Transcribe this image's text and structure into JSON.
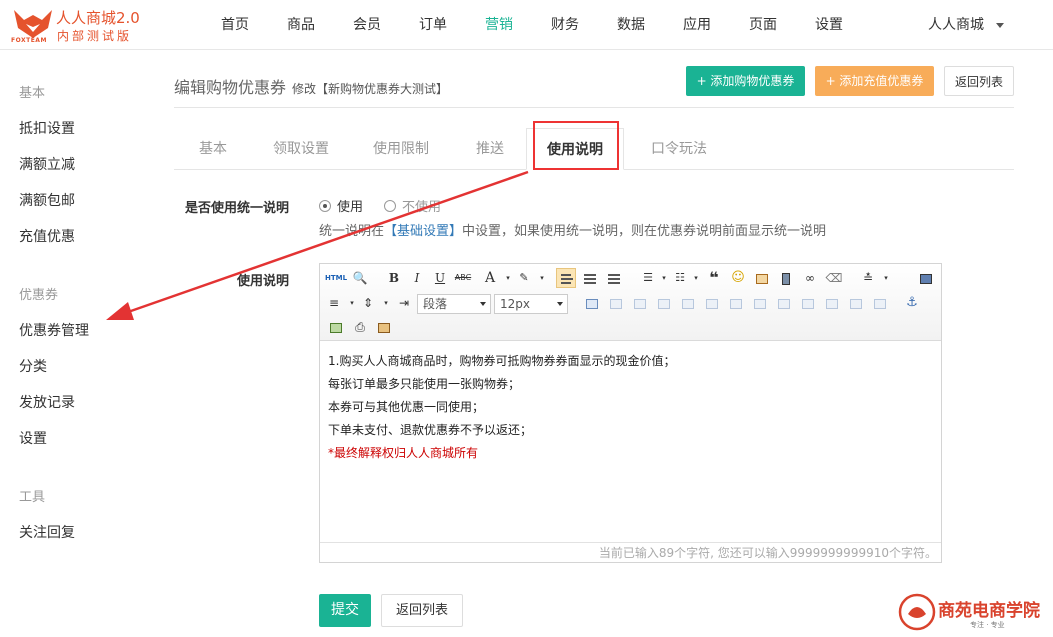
{
  "brand": {
    "name": "人人商城2.0",
    "tagline": "内部测试版",
    "logo_text": "FOXTEAM"
  },
  "nav": {
    "items": [
      {
        "label": "首页"
      },
      {
        "label": "商品"
      },
      {
        "label": "会员"
      },
      {
        "label": "订单"
      },
      {
        "label": "营销",
        "active": true
      },
      {
        "label": "财务"
      },
      {
        "label": "数据"
      },
      {
        "label": "应用"
      },
      {
        "label": "页面"
      },
      {
        "label": "设置"
      }
    ],
    "user": "人人商城"
  },
  "sidebar": {
    "groups": [
      {
        "title": "基本",
        "items": [
          "抵扣设置",
          "满额立减",
          "满额包邮",
          "充值优惠"
        ]
      },
      {
        "title": "优惠券",
        "items": [
          "优惠券管理",
          "分类",
          "发放记录",
          "设置"
        ]
      },
      {
        "title": "工具",
        "items": [
          "关注回复"
        ]
      }
    ]
  },
  "page": {
    "title": "编辑购物优惠券",
    "subtitle": "修改【新购物优惠券大测试】",
    "actions": {
      "add_shop_coupon": "+ 添加购物优惠券",
      "add_recharge_coupon": "+ 添加充值优惠券",
      "back_list": "返回列表"
    }
  },
  "tabs": [
    {
      "label": "基本"
    },
    {
      "label": "领取设置"
    },
    {
      "label": "使用限制"
    },
    {
      "label": "推送"
    },
    {
      "label": "使用说明",
      "active": true
    },
    {
      "label": "口令玩法"
    }
  ],
  "form": {
    "unified_desc_label": "是否使用统一说明",
    "radio_use": "使用",
    "radio_not_use": "不使用",
    "selected": "使用",
    "help_prefix": "统一说明在",
    "help_link": "【基础设置】",
    "help_suffix": "中设置，如果使用统一说明，则在优惠券说明前面显示统一说明",
    "usage_label": "使用说明"
  },
  "editor": {
    "toolbar": {
      "html": "HTML",
      "bold": "B",
      "italic": "I",
      "underline": "U",
      "strike": "ABC",
      "font_color": "A",
      "paragraph_select": "段落",
      "size_select": "12px"
    },
    "content": [
      "1.购买人人商城商品时，购物券可抵购物券券面显示的现金价值；",
      "每张订单最多只能使用一张购物券；",
      "本券可与其他优惠一同使用；",
      "下单未支付、退款优惠券不予以返还；",
      "*最终解释权归人人商城所有"
    ],
    "status": "当前已输入89个字符, 您还可以输入9999999999910个字符。"
  },
  "footer_buttons": {
    "submit": "提交",
    "back": "返回列表"
  },
  "watermark": {
    "text": "商苑电商学院",
    "sub": "专注 · 专业"
  },
  "colors": {
    "accent": "#1ab394",
    "orange": "#f8ac59",
    "brand": "#e5532d",
    "annotation": "#e33333"
  }
}
